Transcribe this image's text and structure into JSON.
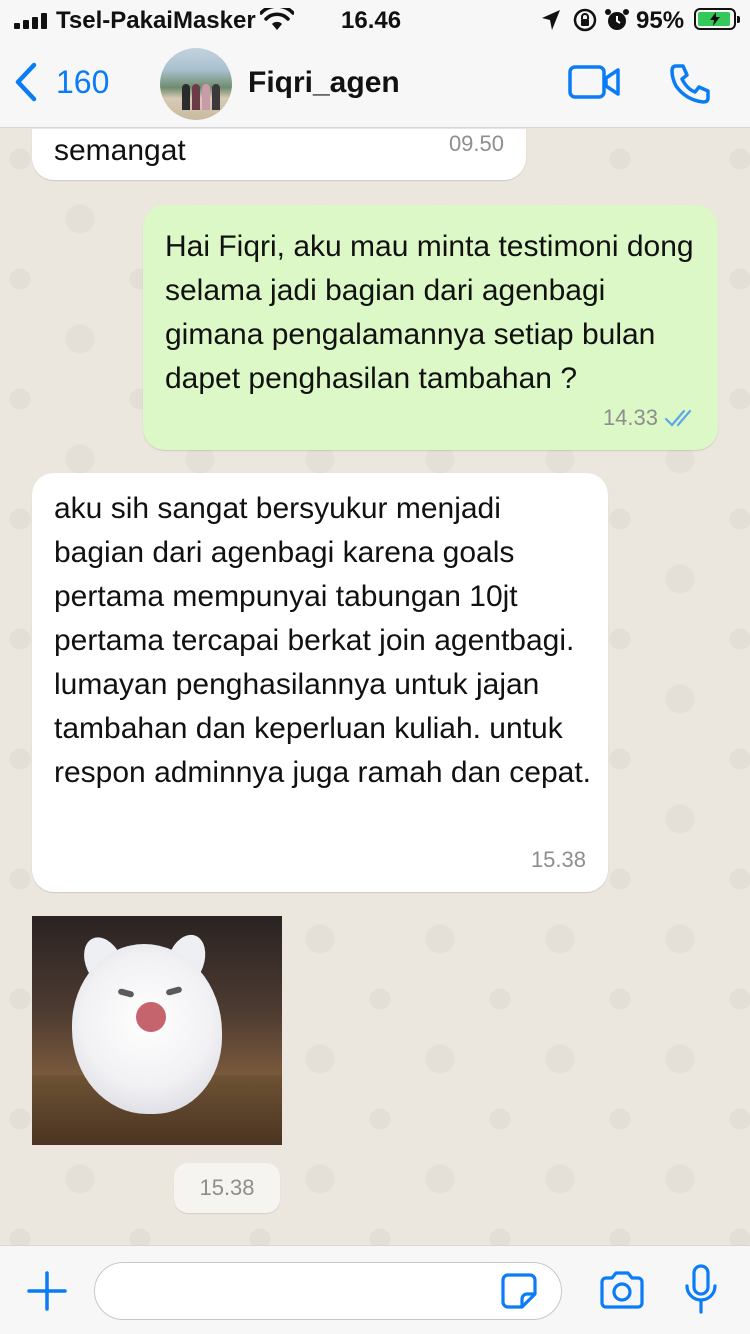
{
  "status_bar": {
    "carrier": "Tsel-PakaiMasker",
    "time": "16.46",
    "battery_percent": "95%",
    "battery_level": 0.95
  },
  "header": {
    "back_count": "160",
    "contact_name": "Fiqri_agen",
    "icons": [
      "chevron-left-icon",
      "video-icon",
      "phone-icon"
    ]
  },
  "messages": [
    {
      "direction": "in",
      "text": "semangat",
      "time": "09.50"
    },
    {
      "direction": "out",
      "text": "Hai Fiqri, aku mau minta testimoni dong selama jadi bagian dari agenbagi gimana pengalamannya setiap bulan dapet penghasilan tambahan ?",
      "time": "14.33",
      "status": "read"
    },
    {
      "direction": "in",
      "text": "aku sih sangat bersyukur menjadi bagian dari agenbagi karena goals pertama mempunyai tabungan 10jt pertama tercapai berkat join agentbagi. lumayan penghasilannya untuk jajan tambahan dan keperluan kuliah. untuk respon adminnya juga ramah dan cepat.",
      "time": "15.38"
    },
    {
      "direction": "in",
      "type": "sticker",
      "time": "15.38"
    }
  ],
  "input": {
    "value": "",
    "icons": [
      "plus-icon",
      "sticker-icon",
      "camera-icon",
      "microphone-icon"
    ]
  },
  "colors": {
    "accent": "#0a7cf5",
    "outgoing_bubble": "#dcf8c6",
    "incoming_bubble": "#ffffff",
    "read_ticks": "#5aa9e6",
    "battery": "#34c759"
  }
}
